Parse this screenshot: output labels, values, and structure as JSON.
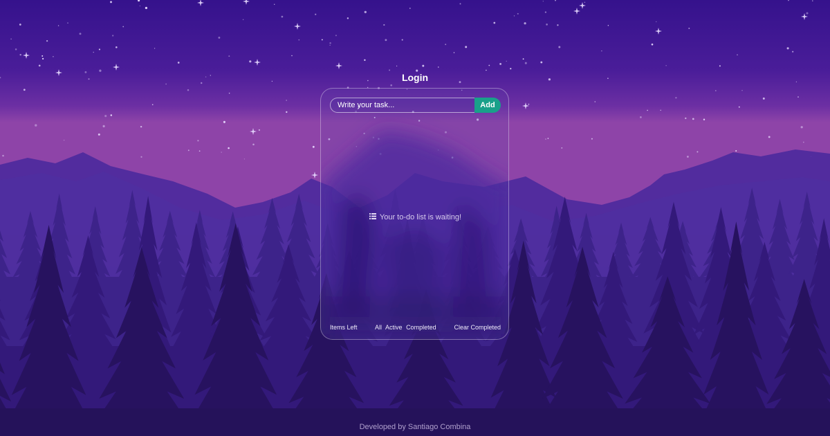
{
  "header": {
    "login_label": "Login"
  },
  "todo": {
    "input_placeholder": "Write your task...",
    "add_label": "Add",
    "empty_message": "Your to-do list is waiting!",
    "empty_icon": "list-icon"
  },
  "footer_controls": {
    "items_left": "Items Left",
    "filter_all": "All",
    "filter_active": "Active",
    "filter_completed": "Completed",
    "clear_completed": "Clear Completed"
  },
  "credit": "Developed by Santiago Combina",
  "colors": {
    "accent": "#19a08a",
    "sky_top": "#3a1490",
    "horizon": "#8b3fa6",
    "forest": "#2a1460"
  }
}
